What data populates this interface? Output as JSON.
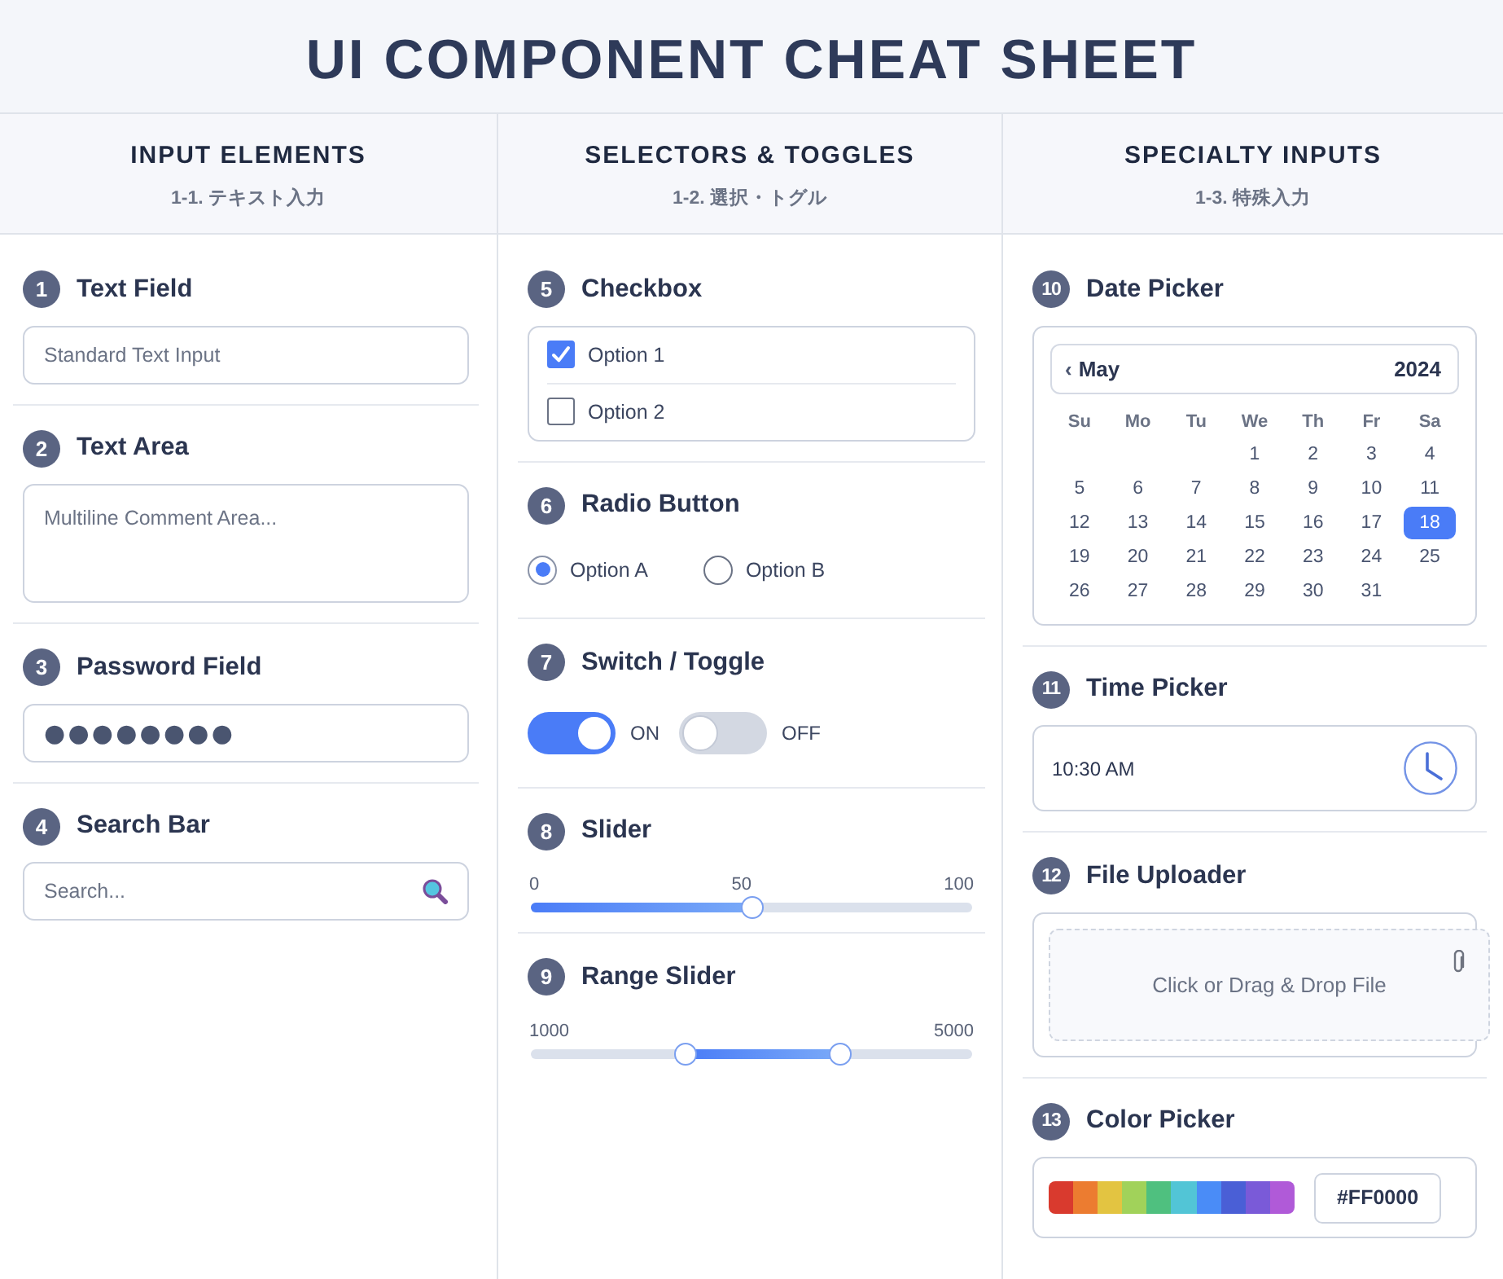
{
  "title": "UI COMPONENT CHEAT SHEET",
  "columns": [
    {
      "heading": "INPUT ELEMENTS",
      "subheading": "1-1. テキスト入力",
      "sections": [
        {
          "number": "1",
          "title": "Text Field",
          "kind": "text_field",
          "placeholder": "Standard Text Input"
        },
        {
          "number": "2",
          "title": "Text Area",
          "kind": "text_area",
          "placeholder": "Multiline Comment Area..."
        },
        {
          "number": "3",
          "title": "Password Field",
          "kind": "password",
          "value": "●●●●●●●●"
        },
        {
          "number": "4",
          "title": "Search Bar",
          "kind": "search",
          "placeholder": "Search..."
        }
      ]
    },
    {
      "heading": "SELECTORS & TOGGLES",
      "subheading": "1-2. 選択・トグル",
      "sections": [
        {
          "number": "5",
          "title": "Checkbox",
          "kind": "checkbox",
          "options": [
            {
              "label": "Option 1",
              "checked": true
            },
            {
              "label": "Option 2",
              "checked": false
            }
          ]
        },
        {
          "number": "6",
          "title": "Radio Button",
          "kind": "radio",
          "options": [
            {
              "label": "Option A",
              "selected": true
            },
            {
              "label": "Option B",
              "selected": false
            }
          ]
        },
        {
          "number": "7",
          "title": "Switch / Toggle",
          "kind": "switch",
          "switches": [
            {
              "label": "ON",
              "on": true
            },
            {
              "label": "OFF",
              "on": false
            }
          ]
        },
        {
          "number": "8",
          "title": "Slider",
          "kind": "slider",
          "scale": [
            "0",
            "50",
            "100"
          ],
          "level": 0.5
        },
        {
          "number": "9",
          "title": "Range Slider",
          "kind": "range_slider",
          "scale": [
            "1000",
            "5000"
          ],
          "thumbs": [
            {
              "level": 0.35
            },
            {
              "level": 0.7
            }
          ]
        }
      ]
    },
    {
      "heading": "SPECIALTY INPUTS",
      "subheading": "1-3. 特殊入力",
      "sections": [
        {
          "number": "10",
          "title": "Date Picker",
          "kind": "date_picker",
          "prev_arrow": "‹",
          "month": "May",
          "year": "2024",
          "weekdays": [
            "Su",
            "Mo",
            "Tu",
            "We",
            "Th",
            "Fr",
            "Sa"
          ],
          "weeks": [
            [
              {
                "label": "1",
                "selected": false
              },
              {
                "label": "2",
                "selected": false
              },
              {
                "label": "3",
                "selected": false
              },
              {
                "label": "4",
                "selected": false
              }
            ],
            [
              {
                "label": "5",
                "selected": false
              },
              {
                "label": "6",
                "selected": false
              },
              {
                "label": "7",
                "selected": false
              },
              {
                "label": "8",
                "selected": false
              },
              {
                "label": "9",
                "selected": false
              },
              {
                "label": "10",
                "selected": false
              },
              {
                "label": "11",
                "selected": false
              }
            ],
            [
              {
                "label": "12",
                "selected": false
              },
              {
                "label": "13",
                "selected": false
              },
              {
                "label": "14",
                "selected": false
              },
              {
                "label": "15",
                "selected": false
              },
              {
                "label": "16",
                "selected": false
              },
              {
                "label": "17",
                "selected": false
              },
              {
                "label": "18",
                "selected": true
              }
            ],
            [
              {
                "label": "19",
                "selected": false
              },
              {
                "label": "20",
                "selected": false
              },
              {
                "label": "21",
                "selected": false
              },
              {
                "label": "22",
                "selected": false
              },
              {
                "label": "23",
                "selected": false
              },
              {
                "label": "24",
                "selected": false
              },
              {
                "label": "25",
                "selected": false
              }
            ],
            [
              {
                "label": "26",
                "selected": false
              },
              {
                "label": "27",
                "selected": false
              },
              {
                "label": "28",
                "selected": false
              },
              {
                "label": "29",
                "selected": false
              },
              {
                "label": "30",
                "selected": false
              },
              {
                "label": "31",
                "selected": false
              }
            ]
          ]
        },
        {
          "number": "11",
          "title": "Time Picker",
          "kind": "time_picker",
          "value": "10:30 AM"
        },
        {
          "number": "12",
          "title": "File Uploader",
          "kind": "file_upload",
          "text": "Click or Drag & Drop File"
        },
        {
          "number": "13",
          "title": "Color Picker",
          "kind": "color_picker",
          "swatches": [
            {
              "color": "#d93a2e"
            },
            {
              "color": "#ec7c30"
            },
            {
              "color": "#e3c441"
            },
            {
              "color": "#a1d25a"
            },
            {
              "color": "#4fc07f"
            },
            {
              "color": "#52c5d6"
            },
            {
              "color": "#4a8cf7"
            },
            {
              "color": "#4a5fd6"
            },
            {
              "color": "#7a5ad8"
            },
            {
              "color": "#b05ad8"
            }
          ],
          "value": "#FF0000"
        }
      ]
    }
  ]
}
